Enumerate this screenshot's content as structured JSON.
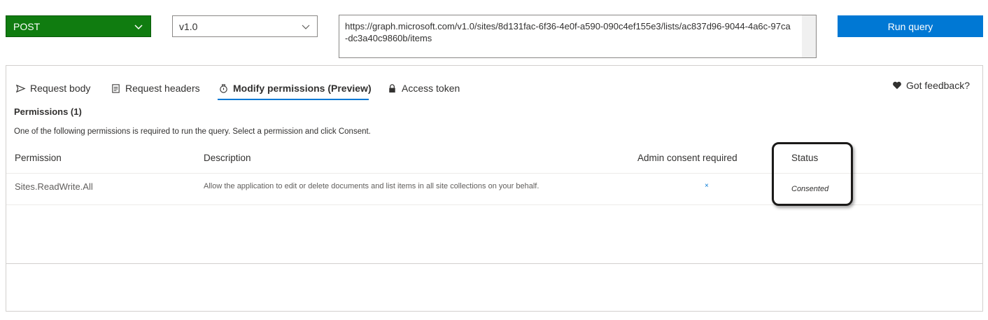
{
  "request": {
    "method": "POST",
    "version": "v1.0",
    "url": "https://graph.microsoft.com/v1.0/sites/8d131fac-6f36-4e0f-a590-090c4ef155e3/lists/ac837d96-9044-4a6c-97ca-dc3a40c9860b/items",
    "run_label": "Run query"
  },
  "tabs": [
    {
      "label": "Request body",
      "icon": "send-icon"
    },
    {
      "label": "Request headers",
      "icon": "document-icon"
    },
    {
      "label": "Modify permissions (Preview)",
      "icon": "permissions-icon",
      "active": true
    },
    {
      "label": "Access token",
      "icon": "lock-icon"
    }
  ],
  "feedback_label": "Got feedback?",
  "permissions": {
    "title": "Permissions (1)",
    "description": "One of the following permissions is required to run the query. Select a permission and click Consent.",
    "columns": [
      "Permission",
      "Description",
      "Admin consent required",
      "Status"
    ],
    "rows": [
      {
        "permission": "Sites.ReadWrite.All",
        "description": "Allow the application to edit or delete documents and list items in all site collections on your behalf.",
        "admin_consent": "×",
        "status": "Consented"
      }
    ]
  },
  "colors": {
    "method_bg": "#107c10",
    "run_bg": "#0078d4",
    "accent": "#0078d4"
  }
}
